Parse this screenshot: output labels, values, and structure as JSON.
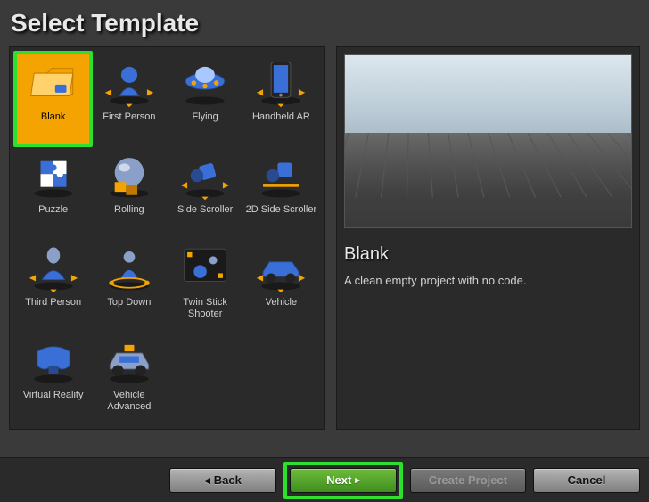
{
  "title": "Select Template",
  "templates": [
    {
      "key": "blank",
      "label": "Blank",
      "icon": "folder",
      "selected": true,
      "highlighted": true
    },
    {
      "key": "first-person",
      "label": "First Person",
      "icon": "pawn"
    },
    {
      "key": "flying",
      "label": "Flying",
      "icon": "ufo"
    },
    {
      "key": "handheld-ar",
      "label": "Handheld AR",
      "icon": "phone"
    },
    {
      "key": "puzzle",
      "label": "Puzzle",
      "icon": "puzzle"
    },
    {
      "key": "rolling",
      "label": "Rolling",
      "icon": "ball"
    },
    {
      "key": "side-scroller",
      "label": "Side Scroller",
      "icon": "run"
    },
    {
      "key": "2d-side-scroller",
      "label": "2D Side Scroller",
      "icon": "run2d"
    },
    {
      "key": "third-person",
      "label": "Third Person",
      "icon": "tp"
    },
    {
      "key": "top-down",
      "label": "Top Down",
      "icon": "topdown"
    },
    {
      "key": "twin-stick-shooter",
      "label": "Twin Stick Shooter",
      "icon": "twinstick"
    },
    {
      "key": "vehicle",
      "label": "Vehicle",
      "icon": "car"
    },
    {
      "key": "virtual-reality",
      "label": "Virtual Reality",
      "icon": "vr"
    },
    {
      "key": "vehicle-advanced",
      "label": "Vehicle Advanced",
      "icon": "caradv"
    }
  ],
  "detail": {
    "title": "Blank",
    "description": "A clean empty project with no code."
  },
  "buttons": {
    "back": "Back",
    "next": "Next",
    "create": "Create Project",
    "cancel": "Cancel"
  },
  "nextHighlighted": true,
  "createDisabled": true
}
